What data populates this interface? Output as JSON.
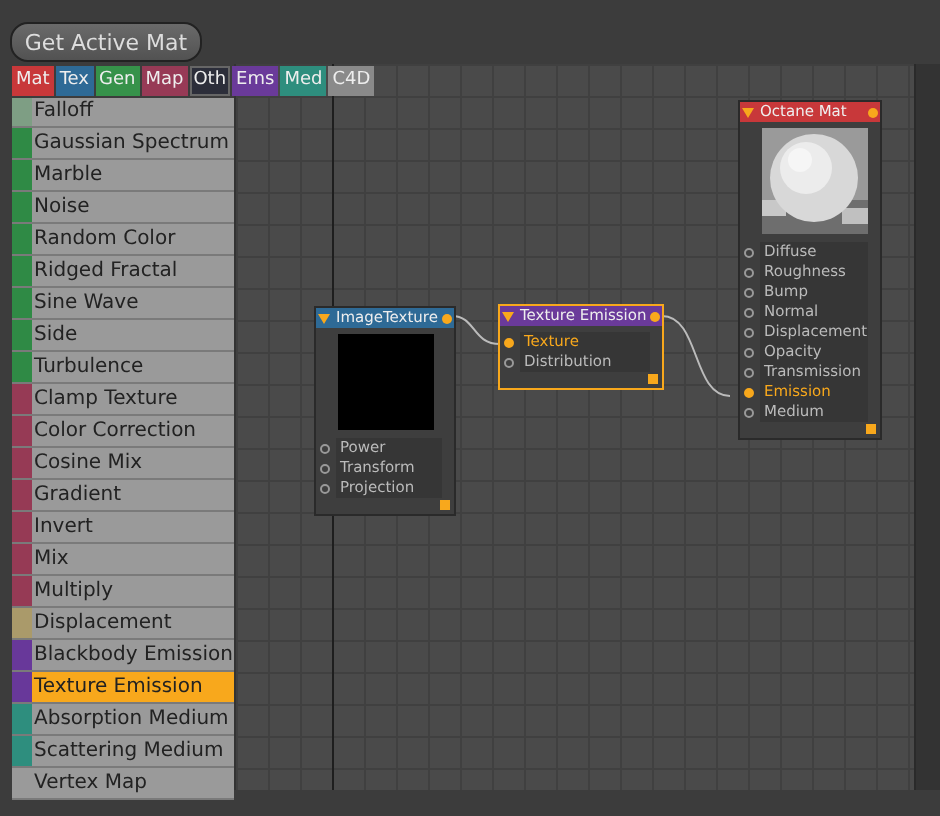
{
  "toolbar": {
    "button": "Get Active Mat"
  },
  "tabs": [
    {
      "label": "Mat",
      "color": "#c8383a",
      "selected": false
    },
    {
      "label": "Tex",
      "color": "#2e6a96",
      "selected": false
    },
    {
      "label": "Gen",
      "color": "#36924a",
      "selected": false
    },
    {
      "label": "Map",
      "color": "#973a56",
      "selected": false
    },
    {
      "label": "Oth",
      "color": "#2c2e3a",
      "selected": true
    },
    {
      "label": "Ems",
      "color": "#6a3a9a",
      "selected": false
    },
    {
      "label": "Med",
      "color": "#2e8e7e",
      "selected": false
    },
    {
      "label": "C4D",
      "color": "#8a8a8a",
      "selected": false
    }
  ],
  "node_list": [
    {
      "label": "Falloff",
      "color": "#7e9e84",
      "selected": false
    },
    {
      "label": "Gaussian Spectrum",
      "color": "#2f8a45",
      "selected": false
    },
    {
      "label": "Marble",
      "color": "#2f8a45",
      "selected": false
    },
    {
      "label": "Noise",
      "color": "#2f8a45",
      "selected": false
    },
    {
      "label": "Random Color",
      "color": "#2f8a45",
      "selected": false
    },
    {
      "label": "Ridged Fractal",
      "color": "#2f8a45",
      "selected": false
    },
    {
      "label": "Sine Wave",
      "color": "#2f8a45",
      "selected": false
    },
    {
      "label": "Side",
      "color": "#2f8a45",
      "selected": false
    },
    {
      "label": "Turbulence",
      "color": "#2f8a45",
      "selected": false
    },
    {
      "label": "Clamp Texture",
      "color": "#963a55",
      "selected": false
    },
    {
      "label": "Color Correction",
      "color": "#963a55",
      "selected": false
    },
    {
      "label": "Cosine Mix",
      "color": "#963a55",
      "selected": false
    },
    {
      "label": "Gradient",
      "color": "#963a55",
      "selected": false
    },
    {
      "label": "Invert",
      "color": "#963a55",
      "selected": false
    },
    {
      "label": "Mix",
      "color": "#963a55",
      "selected": false
    },
    {
      "label": "Multiply",
      "color": "#963a55",
      "selected": false
    },
    {
      "label": "Displacement",
      "color": "#aa9a6a",
      "selected": false
    },
    {
      "label": "Blackbody Emission",
      "color": "#68389a",
      "selected": false
    },
    {
      "label": "Texture Emission",
      "color": "#68389a",
      "selected": true
    },
    {
      "label": "Absorption Medium",
      "color": "#2e8e7e",
      "selected": false
    },
    {
      "label": "Scattering Medium",
      "color": "#2e8e7e",
      "selected": false
    },
    {
      "label": "Vertex Map",
      "selected": false
    }
  ],
  "nodes": [
    {
      "title": "ImageTexture",
      "color": "#2e6a96",
      "selected": false,
      "kind": "texture",
      "inputs": [
        {
          "label": "Power",
          "connected": false
        },
        {
          "label": "Transform",
          "connected": false
        },
        {
          "label": "Projection",
          "connected": false
        }
      ]
    },
    {
      "title": "Texture Emission",
      "color": "#6a3a9a",
      "selected": true,
      "kind": "emission",
      "inputs": [
        {
          "label": "Texture",
          "connected": true
        },
        {
          "label": "Distribution",
          "connected": false
        }
      ]
    },
    {
      "title": "Octane Mat",
      "color": "#c8383a",
      "selected": false,
      "kind": "material",
      "inputs": [
        {
          "label": "Diffuse",
          "connected": false
        },
        {
          "label": "Roughness",
          "connected": false
        },
        {
          "label": "Bump",
          "connected": false
        },
        {
          "label": "Normal",
          "connected": false
        },
        {
          "label": "Displacement",
          "connected": false
        },
        {
          "label": "Opacity",
          "connected": false
        },
        {
          "label": "Transmission",
          "connected": false
        },
        {
          "label": "Emission",
          "connected": true
        },
        {
          "label": "Medium",
          "connected": false
        }
      ]
    }
  ]
}
